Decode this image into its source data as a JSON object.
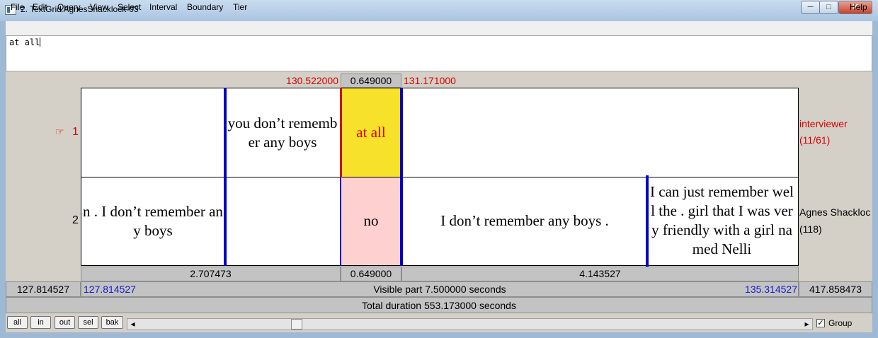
{
  "window": {
    "title": "2. TextGrid AgnesShacklock-03",
    "controls": {
      "minimize": "─",
      "maximize": "□",
      "close": "✕"
    }
  },
  "menu": {
    "items": [
      "File",
      "Edit",
      "Query",
      "View",
      "Select",
      "Interval",
      "Boundary",
      "Tier"
    ],
    "help": "Help"
  },
  "text_editor": {
    "value": "at all"
  },
  "selection": {
    "start": "130.522000",
    "duration": "0.649000",
    "end": "131.171000"
  },
  "tiers": [
    {
      "number": "1",
      "pointer_icon": "☞",
      "name": "interviewer",
      "count": "(11/61)",
      "intervals": {
        "a": "you don’t remember any boys",
        "selected": "at all"
      }
    },
    {
      "number": "2",
      "name": "Agnes Shackloc",
      "count": "(118)",
      "intervals": {
        "a": "n . I don’t remember any boys",
        "b": "no",
        "c": "I don’t remember any boys .",
        "d": "I can just remember well the . girl that I was very friendly with a girl named Nelli"
      }
    }
  ],
  "durations_row": {
    "left": "2.707473",
    "mid": "0.649000",
    "right": "4.143527"
  },
  "visible_row": {
    "left_outer": "127.814527",
    "left": "127.814527",
    "label": "Visible part 7.500000 seconds",
    "right": "135.314527",
    "right_outer": "417.858473"
  },
  "total_row": {
    "label": "Total duration 553.173000 seconds"
  },
  "nav_buttons": [
    "all",
    "in",
    "out",
    "sel",
    "bak"
  ],
  "scroll": {
    "left_arrow": "◂",
    "right_arrow": "▸"
  },
  "group_checkbox": {
    "label": "Group",
    "checked": true,
    "check_glyph": "✓"
  },
  "colors": {
    "selection": "#f8e12a",
    "selected_other_tier": "#ffd0d0",
    "boundary": "#0000c8",
    "time_red": "#d40000",
    "time_blue": "#1919c8"
  }
}
